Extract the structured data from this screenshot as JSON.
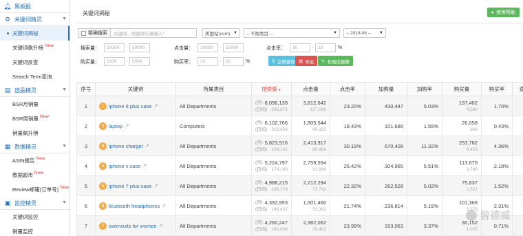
{
  "sidebar": {
    "dashboard": "黑板报",
    "keyword_section": "关键词精灵",
    "keyword_items": [
      {
        "label": "关键词揭秘",
        "new": ""
      },
      {
        "label": "关键词飙升榜",
        "new": "New"
      },
      {
        "label": "关键词反查",
        "new": ""
      },
      {
        "label": "Search Term查询",
        "new": ""
      }
    ],
    "product_section": "选品精灵",
    "product_items": [
      {
        "label": "BSR月销量",
        "new": ""
      },
      {
        "label": "BSR周销量",
        "new": "New"
      },
      {
        "label": "销量飙升榜",
        "new": ""
      }
    ],
    "data_section": "数据精灵",
    "data_items": [
      {
        "label": "ASIN报告",
        "new": "New"
      },
      {
        "label": "数据超市",
        "new": "New"
      },
      {
        "label": "Review邮箱(订单号)",
        "new": "New"
      }
    ],
    "monitor_section": "监控精灵",
    "monitor_items": [
      {
        "label": "关键词监控",
        "new": ""
      },
      {
        "label": "销量监控",
        "new": ""
      }
    ]
  },
  "header": {
    "title": "关键词揭秘",
    "help_label": "使用帮助"
  },
  "filters": {
    "precise_label": "精确搜索",
    "keyword_placeholder": "关键词，限面限行查输入*",
    "site": "美国站(com)",
    "category": "-- 不限类目 --",
    "month": "-- 2018-06 --",
    "search_volume_label": "搜索量：",
    "search_volume_min": "10000",
    "search_volume_max": "50000",
    "clicks_label": "点击量：",
    "clicks_min": "10000",
    "clicks_max": "50000",
    "ctr_label": "点击率：",
    "ctr_min": "10",
    "ctr_max": "20",
    "purchases_label": "购买量：",
    "purchases_min": "1000",
    "purchases_max": "5000",
    "conversion_label": "购买率：",
    "conversion_min": "10",
    "conversion_max": "20",
    "percent": "%",
    "query_btn": "立即查询",
    "export_btn": "导出",
    "long_tail_btn": "长尾挖掘飙"
  },
  "table": {
    "headers": [
      "序号",
      "关键词",
      "所属类目",
      "搜索量",
      "点击量",
      "点击率",
      "加购量",
      "加购率",
      "购买量",
      "购买率",
      "查看详情"
    ],
    "month_prefix": "(月)",
    "day_prefix": "(日均)",
    "rows": [
      {
        "idx": "1",
        "keyword": "iphone 8 plus case",
        "category": "All Departments",
        "search_month": "8,096,139",
        "search_day": "266,871",
        "clicks": "3,812,642",
        "clicks_day": "127,088",
        "ctr": "23.20%",
        "cart": "430,447",
        "cart_rate": "5.03%",
        "buy": "137,402",
        "buy_day": "4,580",
        "buy_rate": "1.70%"
      },
      {
        "idx": "2",
        "keyword": "laptop",
        "category": "Computers",
        "search_month": "6,102,766",
        "search_day": "203,426",
        "clicks": "1,805,544",
        "clicks_day": "60,185",
        "ctr": "18.43%",
        "cart": "101,686",
        "cart_rate": "1.55%",
        "buy": "26,058",
        "buy_day": "868",
        "buy_rate": "0.43%"
      },
      {
        "idx": "3",
        "keyword": "iphone charger",
        "category": "All Departments",
        "search_month": "5,823,916",
        "search_day": "194,131",
        "clicks": "2,413,917",
        "clicks_day": "80,464",
        "ctr": "30.19%",
        "cart": "670,409",
        "cart_rate": "11.32%",
        "buy": "253,782",
        "buy_day": "8,459",
        "buy_rate": "4.36%"
      },
      {
        "idx": "4",
        "keyword": "iphone x case",
        "category": "All Departments",
        "search_month": "5,224,797",
        "search_day": "174,160",
        "clicks": "2,759,594",
        "clicks_day": "91,986",
        "ctr": "25.42%",
        "cart": "304,965",
        "cart_rate": "5.51%",
        "buy": "113,675",
        "buy_day": "3,789",
        "buy_rate": "2.18%"
      },
      {
        "idx": "5",
        "keyword": "iphone 7 plus case",
        "category": "All Departments",
        "search_month": "4,988,215",
        "search_day": "166,274",
        "clicks": "2,212,294",
        "clicks_day": "73,743",
        "ctr": "22.32%",
        "cart": "262,528",
        "cart_rate": "5.02%",
        "buy": "75,637",
        "buy_day": "2,521",
        "buy_rate": "1.52%"
      },
      {
        "idx": "6",
        "keyword": "bluetooth headphones",
        "category": "All Departments",
        "search_month": "4,392,953",
        "search_day": "146,432",
        "clicks": "1,601,466",
        "clicks_day": "53,382",
        "ctr": "21.74%",
        "cart": "236,814",
        "cart_rate": "5.19%",
        "buy": "101,368",
        "buy_day": "3,378",
        "buy_rate": "2.31%"
      },
      {
        "idx": "7",
        "keyword": "swimsuits for women",
        "category": "All Departments",
        "search_month": "4,260,247",
        "search_day": "142,008",
        "clicks": "2,382,062",
        "clicks_day": "79,402",
        "ctr": "23.99%",
        "cart": "153,063",
        "cart_rate": "3.37%",
        "buy": "30,152",
        "buy_day": "1,005",
        "buy_rate": "0.71%"
      }
    ]
  },
  "watermark": "曾德威",
  "colors": {
    "primary": "#2a6fb0",
    "success": "#5cb85c",
    "danger": "#d9534f",
    "info": "#5bc0de",
    "warning": "#f0ad4e"
  }
}
